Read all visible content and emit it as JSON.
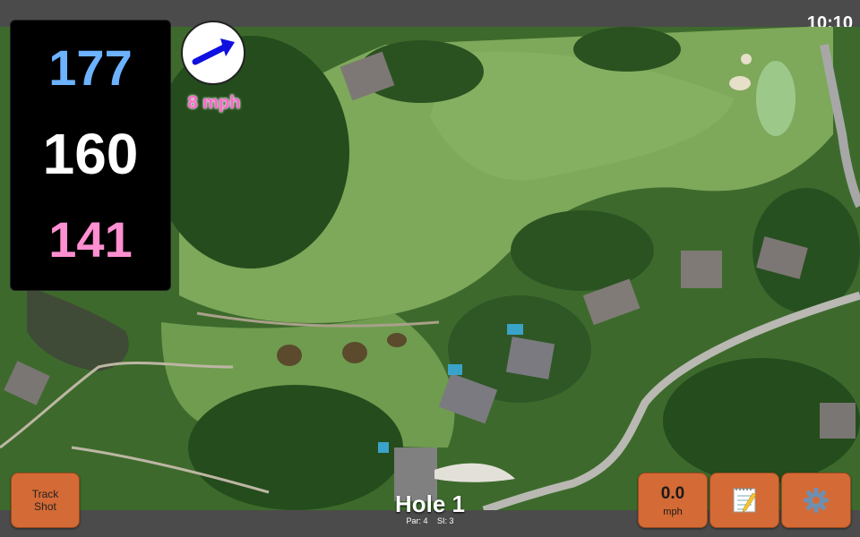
{
  "status_bar": {
    "time": "10:10"
  },
  "distances": {
    "back": "177",
    "center": "160",
    "front": "141"
  },
  "wind": {
    "speed": "8 mph",
    "icon": "arrow-icon"
  },
  "buttons": {
    "track_shot_line1": "Track",
    "track_shot_line2": "Shot",
    "speed_value": "0.0",
    "speed_unit": "mph",
    "notes_icon": "notepad-icon",
    "settings_icon": "gear-icon"
  },
  "hole": {
    "title": "Hole 1",
    "par": "Par: 4",
    "si": "SI: 3"
  },
  "colors": {
    "back": "#6cb2ff",
    "center": "#ffffff",
    "front": "#ff8fd0",
    "button": "#d46a35",
    "wind_text": "#ff66cc"
  }
}
